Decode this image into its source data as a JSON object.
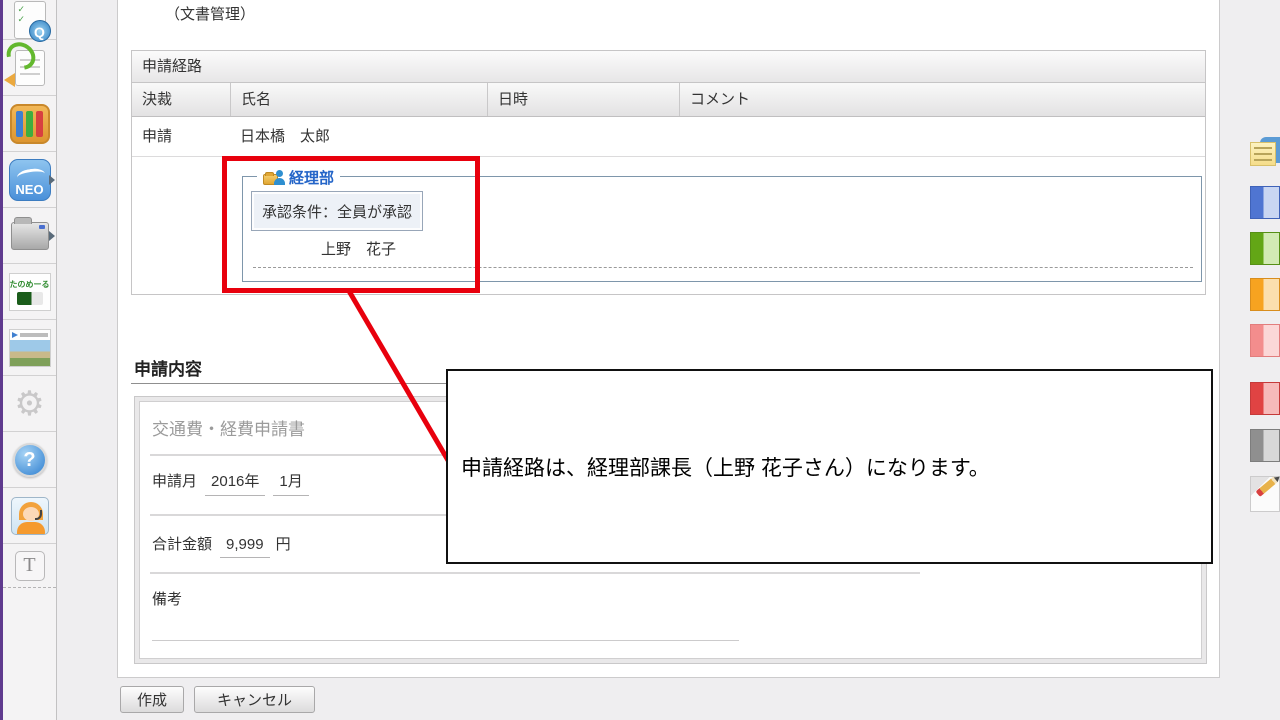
{
  "window": {
    "breadcrumb": "（文書管理）"
  },
  "sidebar": {
    "items": [
      {
        "icon": "document-approval-check-icon"
      },
      {
        "icon": "document-circulation-icon"
      },
      {
        "icon": "document-management-binders-icon"
      },
      {
        "icon": "desknets-neo-logo-icon",
        "flyout": true
      },
      {
        "icon": "folder-icon",
        "flyout": true
      },
      {
        "icon": "tanomail-logo-icon"
      },
      {
        "icon": "travel-photo-banner-icon"
      },
      {
        "icon": "settings-gear-icon"
      },
      {
        "icon": "help-question-icon"
      },
      {
        "icon": "support-operator-icon"
      },
      {
        "icon": "text-size-icon"
      }
    ],
    "gear_glyph": "⚙",
    "help_glyph": "?",
    "neo_label": "NEO",
    "t_label": "T",
    "tanomail_label": "たのめーる"
  },
  "route_table": {
    "title": "申請経路",
    "columns": [
      "決裁",
      "氏名",
      "日時",
      "コメント"
    ],
    "rows": [
      {
        "kessai": "申請",
        "name": "日本橋　太郎",
        "datetime": "",
        "comment": ""
      }
    ],
    "group": {
      "name": "経理部",
      "condition": "承認条件：全員が承認",
      "member": "上野　花子"
    }
  },
  "annotation": {
    "callout_text": "申請経路は、経理部課長（上野 花子さん）になります。",
    "highlight_color": "#e8000d"
  },
  "application": {
    "heading": "申請内容",
    "form": {
      "title": "交通費・経費申請書",
      "fields": [
        {
          "label": "申請月",
          "value1": "2016年",
          "value2": "1月"
        },
        {
          "label": "合計金額",
          "value1": "9,999",
          "suffix": "円"
        },
        {
          "label": "備考",
          "value1": ""
        }
      ]
    }
  },
  "actions": {
    "create_label": "作成",
    "cancel_label": "キャンセル"
  },
  "right_rail": {
    "items": [
      {
        "icon": "sticky-note-icon"
      },
      {
        "icon": "label-blue-icon",
        "color": "#4f75d2"
      },
      {
        "icon": "label-green-icon",
        "color": "#63a616"
      },
      {
        "icon": "label-orange-icon",
        "color": "#f7a320"
      },
      {
        "icon": "label-pink-icon",
        "color": "#f38d8d"
      },
      {
        "icon": "label-red-icon",
        "color": "#e04343"
      },
      {
        "icon": "label-gray-icon",
        "color": "#8f8f8f"
      },
      {
        "icon": "pencil-edit-icon"
      }
    ]
  },
  "colors": {
    "accent_purple": "#5f3a8e",
    "group_border_blue": "#7e96ab",
    "group_legend_blue": "#2465c8",
    "highlight_red": "#e8000d"
  }
}
